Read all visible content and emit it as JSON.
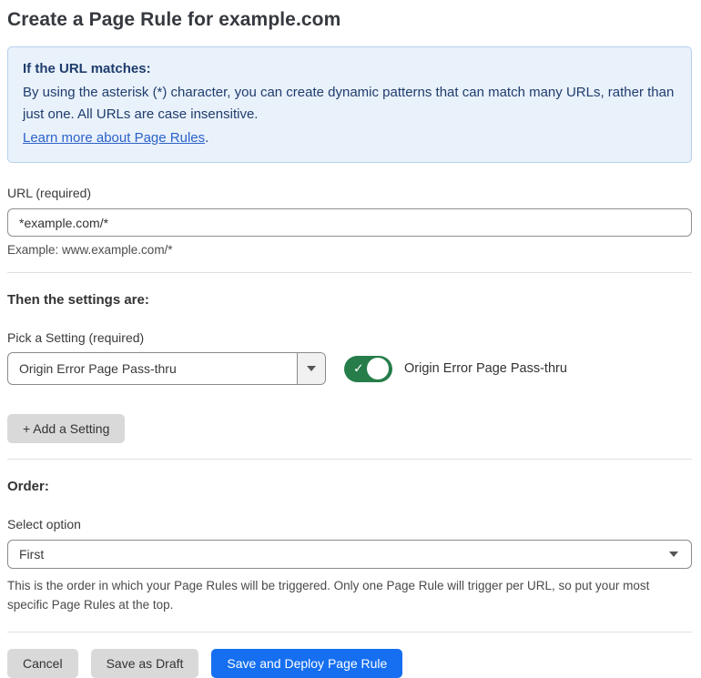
{
  "page": {
    "title": "Create a Page Rule for example.com"
  },
  "info_box": {
    "heading": "If the URL matches:",
    "body": "By using the asterisk (*) character, you can create dynamic patterns that can match many URLs, rather than just one. All URLs are case insensitive.",
    "link_text": "Learn more about Page Rules",
    "link_suffix": "."
  },
  "url_field": {
    "label": "URL (required)",
    "value": "*example.com/*",
    "helper": "Example: www.example.com/*"
  },
  "settings_section": {
    "heading": "Then the settings are:",
    "picker_label": "Pick a Setting (required)",
    "picker_value": "Origin Error Page Pass-thru",
    "toggle": {
      "state": "on",
      "check_glyph": "✓",
      "label": "Origin Error Page Pass-thru"
    },
    "add_setting_button": "+ Add a Setting"
  },
  "order_section": {
    "heading": "Order:",
    "select_label": "Select option",
    "select_value": "First",
    "helper": "This is the order in which your Page Rules will be triggered. Only one Page Rule will trigger per URL, so put your most specific Page Rules at the top."
  },
  "footer": {
    "cancel_label": "Cancel",
    "save_draft_label": "Save as Draft",
    "save_deploy_label": "Save and Deploy Page Rule"
  },
  "colors": {
    "accent_blue": "#156ff0",
    "toggle_green": "#267d4a",
    "info_bg": "#e9f1fb",
    "info_border": "#b7d0ec",
    "info_text": "#1f3d6d",
    "link_blue": "#2c62c9"
  }
}
